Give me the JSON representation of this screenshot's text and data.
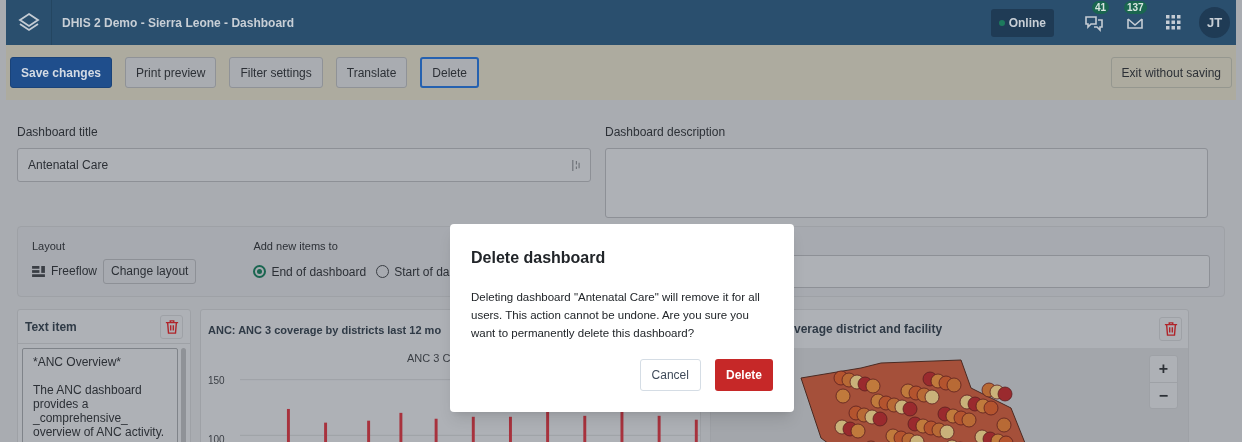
{
  "header": {
    "title": "DHIS 2 Demo - Sierra Leone - Dashboard",
    "online": {
      "label": "Online",
      "connected": true
    },
    "interpretations_count": "41",
    "messages_count": "137",
    "avatar_initials": "JT"
  },
  "toolbar": {
    "buttons": [
      {
        "label": "Save changes",
        "kind": "primary",
        "focused": false
      },
      {
        "label": "Print preview",
        "kind": "secondary",
        "focused": false
      },
      {
        "label": "Filter settings",
        "kind": "secondary",
        "focused": false
      },
      {
        "label": "Translate",
        "kind": "secondary",
        "focused": false
      },
      {
        "label": "Delete",
        "kind": "secondary",
        "focused": true
      }
    ],
    "exit_button": "Exit without saving"
  },
  "form": {
    "title_label": "Dashboard title",
    "title_value": "Antenatal Care",
    "description_label": "Dashboard description"
  },
  "layout_panel": {
    "layout_label": "Layout",
    "layout_value": "Freeflow",
    "change_layout_button": "Change layout",
    "add_items_label": "Add new items to",
    "options": [
      {
        "label": "End of dashboard",
        "selected": true
      },
      {
        "label": "Start of da",
        "selected": false
      }
    ]
  },
  "items": [
    {
      "kind": "text",
      "title": "Text item",
      "text": "*ANC Overview*\n\nThe ANC dashboard provides a _comprehensive_ overview of ANC activity."
    },
    {
      "kind": "chart",
      "title": "ANC: ANC 3 coverage by districts last 12 mo",
      "subtitle": "ANC 3 C",
      "y_axis_labels": [
        "150",
        "100"
      ]
    },
    {
      "kind": "map",
      "title": "verage district and facility",
      "zoom_in": "+",
      "zoom_out": "−"
    }
  ],
  "dialog": {
    "title": "Delete dashboard",
    "message": "Deleting dashboard \"Antenatal Care\" will remove it for all users. This action cannot be undone. Are you sure you want to permanently delete this dashboard?",
    "cancel": "Cancel",
    "confirm": "Delete"
  }
}
